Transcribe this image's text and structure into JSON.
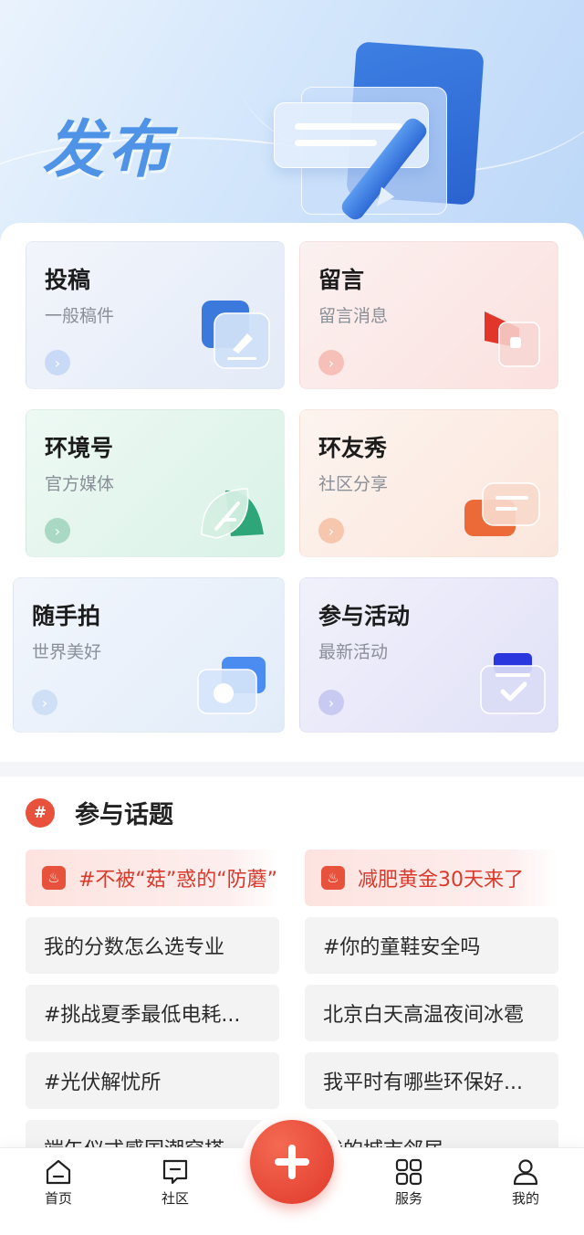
{
  "hero": {
    "title": "发布"
  },
  "tiles": [
    {
      "title": "投稿",
      "subtitle": "一般稿件",
      "icon": "edit-document-icon",
      "accent": "#3d7fe3"
    },
    {
      "title": "留言",
      "subtitle": "留言消息",
      "icon": "megaphone-icon",
      "accent": "#e8513c"
    },
    {
      "title": "环境号",
      "subtitle": "官方媒体",
      "icon": "leaf-icon",
      "accent": "#2fb27d"
    },
    {
      "title": "环友秀",
      "subtitle": "社区分享",
      "icon": "chat-bubble-icon",
      "accent": "#ef7a3d"
    },
    {
      "title": "随手拍",
      "subtitle": "世界美好",
      "icon": "camera-icon",
      "accent": "#4b8ff0"
    },
    {
      "title": "参与活动",
      "subtitle": "最新活动",
      "icon": "clipboard-check-icon",
      "accent": "#3342e0"
    }
  ],
  "topics": {
    "title": "参与话题",
    "badge": "#",
    "items": [
      {
        "label": "#不被“菇”惑的“防蘑”",
        "hot": true
      },
      {
        "label": "减肥黄金30天来了",
        "hot": true
      },
      {
        "label": "我的分数怎么选专业",
        "hot": false
      },
      {
        "label": "#你的童鞋安全吗",
        "hot": false
      },
      {
        "label": "#挑战夏季最低电耗...",
        "hot": false
      },
      {
        "label": "北京白天高温夜间冰雹",
        "hot": false
      },
      {
        "label": "#光伏解忧所",
        "hot": false
      },
      {
        "label": "我平时有哪些环保好...",
        "hot": false
      },
      {
        "label": "端午仪式感国潮穿搭",
        "hot": false
      },
      {
        "label": "我的城市邻居",
        "hot": false
      }
    ]
  },
  "tabbar": {
    "items": [
      {
        "label": "首页",
        "icon": "home-icon"
      },
      {
        "label": "社区",
        "icon": "message-icon"
      },
      {
        "label": "服务",
        "icon": "grid-icon"
      },
      {
        "label": "我的",
        "icon": "user-icon"
      }
    ],
    "fab_icon": "plus-icon"
  }
}
